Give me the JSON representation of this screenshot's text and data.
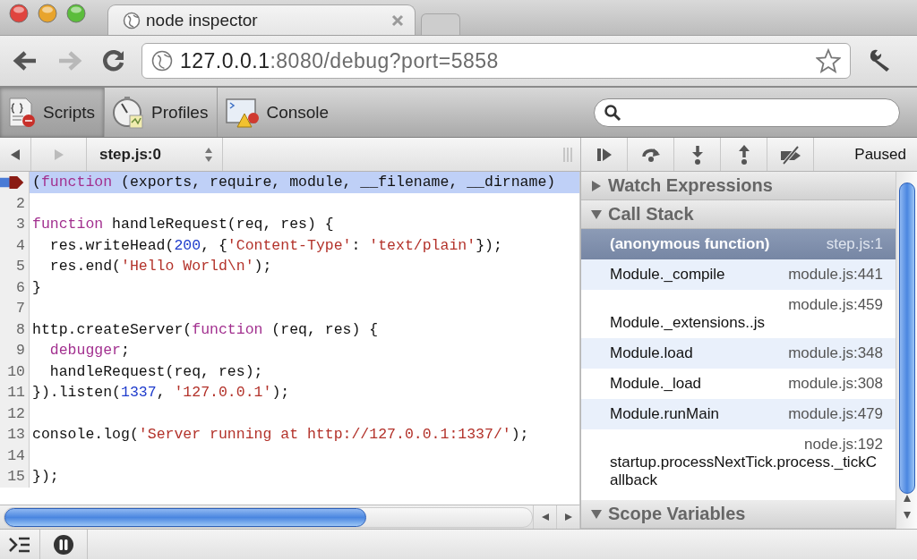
{
  "browser": {
    "tab": {
      "title": "node inspector"
    },
    "back_disabled": false,
    "forward_disabled": true,
    "address": {
      "host": "127.0.0.1",
      "path": ":8080/debug?port=5858"
    }
  },
  "devtools": {
    "panels": [
      {
        "label": "Scripts",
        "kind": "scripts",
        "selected": true
      },
      {
        "label": "Profiles",
        "kind": "profiles",
        "selected": false
      },
      {
        "label": "Console",
        "kind": "console",
        "selected": false
      }
    ]
  },
  "debugger_toolbar": {
    "history_back_disabled": false,
    "history_forward_disabled": true,
    "file": "step.js:0",
    "status": "Paused"
  },
  "code": {
    "lines": [
      {
        "current": true,
        "tokens": [
          {
            "kind": "plain",
            "text": "("
          },
          {
            "kind": "keyword",
            "text": "function"
          },
          {
            "kind": "plain",
            "text": " (exports, require, module, __filename, __dirname)"
          }
        ]
      },
      {
        "number": "2",
        "current": false
      },
      {
        "number": "3",
        "current": false,
        "tokens": [
          {
            "kind": "keyword",
            "text": "function"
          },
          {
            "kind": "plain",
            "text": " handleRequest(req, res) {"
          }
        ]
      },
      {
        "number": "4",
        "current": false,
        "indented": true,
        "tokens": [
          {
            "kind": "plain",
            "text": "res.writeHead("
          },
          {
            "kind": "number",
            "text": "200"
          },
          {
            "kind": "plain",
            "text": ", {"
          },
          {
            "kind": "string",
            "text": "'Content-Type'"
          },
          {
            "kind": "plain",
            "text": ": "
          },
          {
            "kind": "string",
            "text": "'text/plain'"
          },
          {
            "kind": "plain",
            "text": "});"
          }
        ]
      },
      {
        "number": "5",
        "current": false,
        "indented": true,
        "tokens": [
          {
            "kind": "plain",
            "text": "res.end("
          },
          {
            "kind": "string",
            "text": "'Hello World\\n'"
          },
          {
            "kind": "plain",
            "text": ");"
          }
        ]
      },
      {
        "number": "6",
        "current": false,
        "tokens": [
          {
            "kind": "plain",
            "text": "}"
          }
        ]
      },
      {
        "number": "7",
        "current": false
      },
      {
        "number": "8",
        "current": false,
        "tokens": [
          {
            "kind": "plain",
            "text": "http.createServer("
          },
          {
            "kind": "keyword",
            "text": "function"
          },
          {
            "kind": "plain",
            "text": " (req, res) {"
          }
        ]
      },
      {
        "number": "9",
        "current": false,
        "indented": true,
        "tokens": [
          {
            "kind": "keyword",
            "text": "debugger"
          },
          {
            "kind": "plain",
            "text": ";"
          }
        ]
      },
      {
        "number": "10",
        "current": false,
        "indented": true,
        "tokens": [
          {
            "kind": "plain",
            "text": "handleRequest(req, res);"
          }
        ]
      },
      {
        "number": "11",
        "current": false,
        "tokens": [
          {
            "kind": "plain",
            "text": "}).listen("
          },
          {
            "kind": "number",
            "text": "1337"
          },
          {
            "kind": "plain",
            "text": ", "
          },
          {
            "kind": "string",
            "text": "'127.0.0.1'"
          },
          {
            "kind": "plain",
            "text": ");"
          }
        ]
      },
      {
        "number": "12",
        "current": false
      },
      {
        "number": "13",
        "current": false,
        "tokens": [
          {
            "kind": "plain",
            "text": "console.log("
          },
          {
            "kind": "string",
            "text": "'Server running at http://127.0.0.1:1337/'"
          },
          {
            "kind": "plain",
            "text": ");"
          }
        ]
      },
      {
        "number": "14",
        "current": false
      },
      {
        "number": "15",
        "current": false,
        "tokens": [
          {
            "kind": "plain",
            "text": "});"
          }
        ]
      }
    ]
  },
  "sidebar": {
    "sections": [
      {
        "title": "Watch Expressions",
        "kind": "watch",
        "expanded": false
      },
      {
        "title": "Call Stack",
        "kind": "call_stack",
        "expanded": true,
        "frames": [
          {
            "function": "(anonymous function)",
            "location": "step.js:1",
            "selected": true
          },
          {
            "function": "Module._compile",
            "location": "module.js:441",
            "selected": false
          },
          {
            "function": "Module._extensions..js",
            "location": "module.js:459",
            "selected": false
          },
          {
            "function": "Module.load",
            "location": "module.js:348",
            "selected": false
          },
          {
            "function": "Module._load",
            "location": "module.js:308",
            "selected": false
          },
          {
            "function": "Module.runMain",
            "location": "module.js:479",
            "selected": false
          },
          {
            "function": "startup.processNextTick.process._tickCallback",
            "location": "node.js:192",
            "selected": false
          }
        ]
      },
      {
        "title": "Scope Variables",
        "kind": "scope",
        "expanded": true
      }
    ]
  }
}
